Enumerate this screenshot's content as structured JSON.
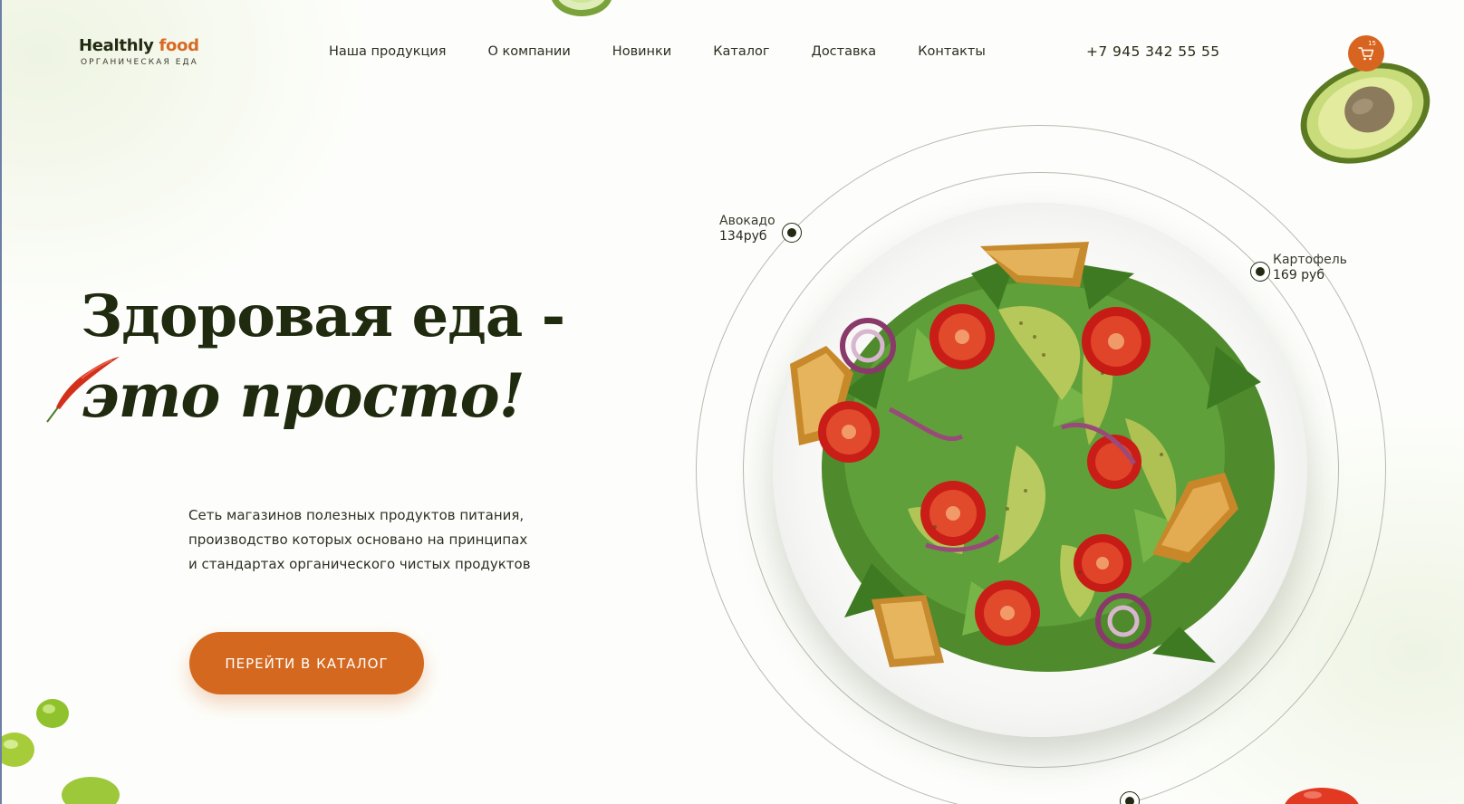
{
  "brand": {
    "name_main": "Healthly",
    "name_accent": "food",
    "tagline": "ОРГАНИЧЕСКАЯ ЕДА",
    "accent_color": "#d86a24"
  },
  "nav": [
    {
      "label": "Наша продукция"
    },
    {
      "label": "О компании"
    },
    {
      "label": "Новинки"
    },
    {
      "label": "Каталог"
    },
    {
      "label": "Доставка"
    },
    {
      "label": "Контакты"
    }
  ],
  "phone": "+7 945 342 55 55",
  "cart": {
    "count": "15",
    "icon": "cart-icon",
    "color": "#d8651f"
  },
  "hero": {
    "title_line1": "Здоровая еда -",
    "title_line2": "это просто!",
    "description_line1": "Сеть магазинов полезных продуктов питания,",
    "description_line2": "производство которых основано на принципах",
    "description_line3": "и стандартах органического чистых продуктов",
    "cta_label": "ПЕРЕЙТИ В КАТАЛОГ",
    "cta_color": "#d4681f"
  },
  "hotspots": [
    {
      "name": "Авокадо",
      "price": "134руб"
    },
    {
      "name": "Картофель",
      "price": "169 руб"
    }
  ]
}
